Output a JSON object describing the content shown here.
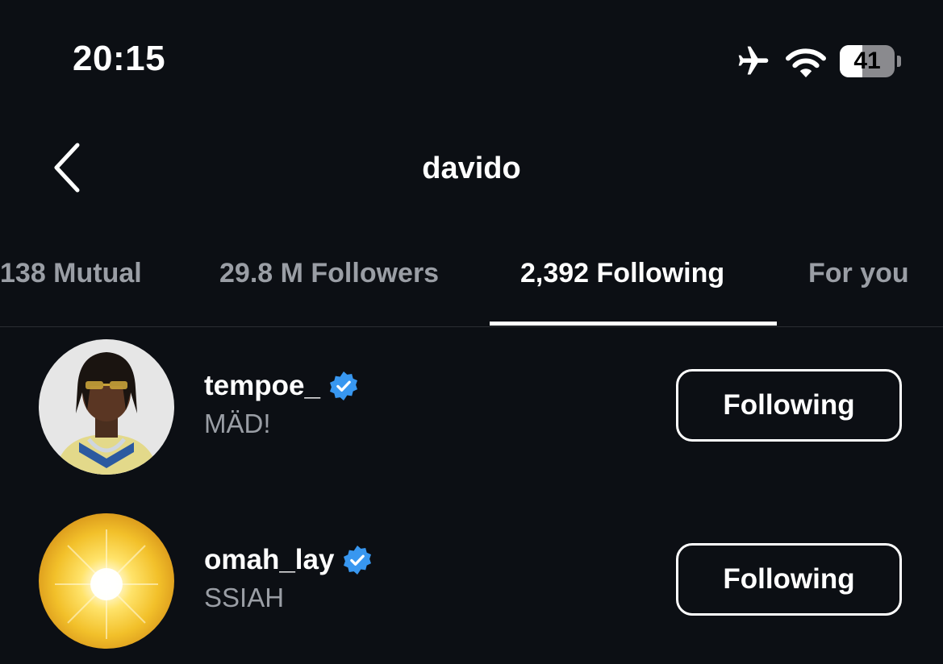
{
  "status_bar": {
    "time": "20:15",
    "battery_level": "41",
    "icons": [
      "airplane-icon",
      "wifi-icon",
      "battery-icon"
    ]
  },
  "header": {
    "title": "davido",
    "back_icon": "chevron-left-icon"
  },
  "tabs": [
    {
      "label": "138 Mutual",
      "active": false
    },
    {
      "label": "29.8 M Followers",
      "active": false
    },
    {
      "label": "2,392 Following",
      "active": true
    },
    {
      "label": "For you",
      "active": false
    }
  ],
  "users": [
    {
      "username": "tempoe_",
      "subtitle": "MÄD!",
      "verified": true,
      "button_label": "Following"
    },
    {
      "username": "omah_lay",
      "subtitle": "SSIAH",
      "verified": true,
      "button_label": "Following"
    }
  ],
  "colors": {
    "background": "#0c0f14",
    "verified_badge": "#3897f0",
    "inactive_tab": "#9a9ea5"
  }
}
